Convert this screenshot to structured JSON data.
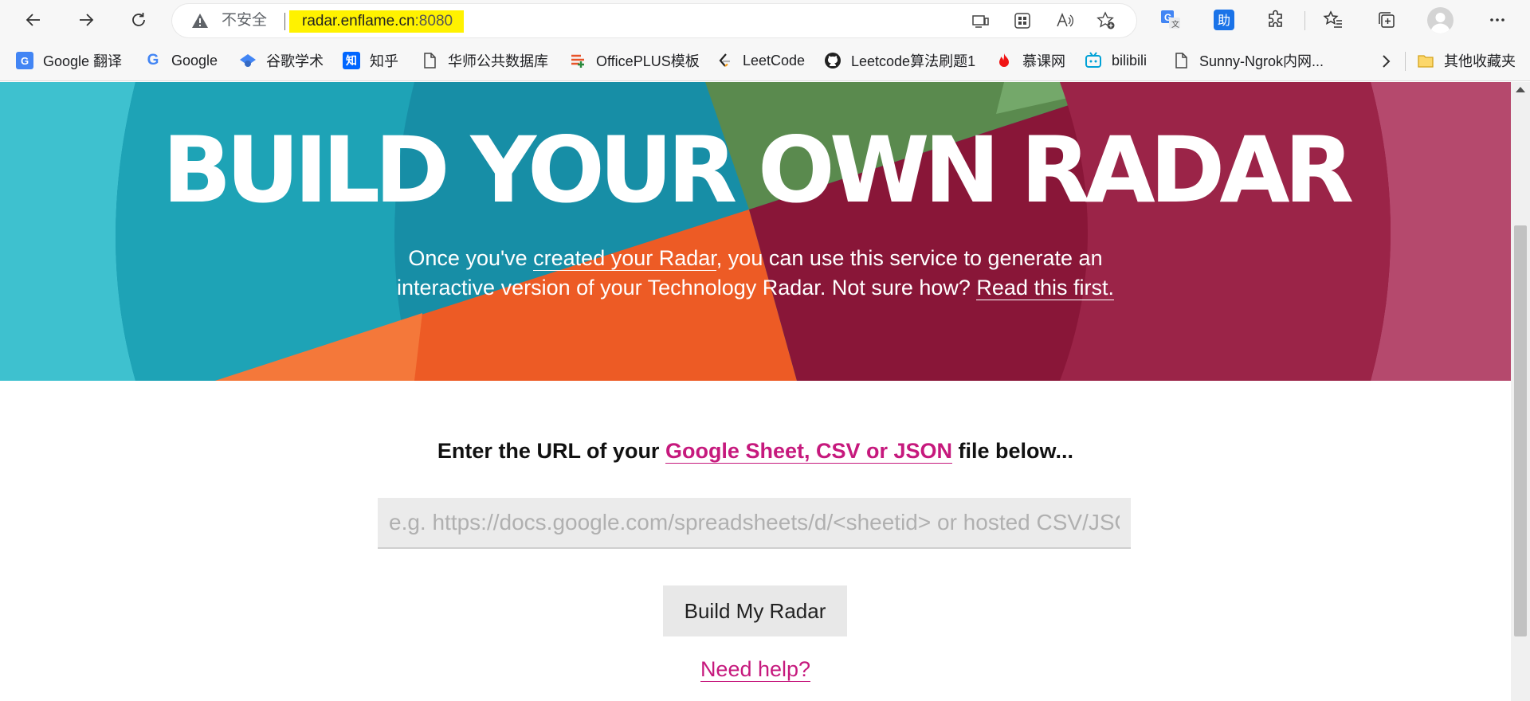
{
  "browser": {
    "security_label": "不安全",
    "url_host": "radar.enflame.cn",
    "url_port": ":8080",
    "help_extension_label": "助"
  },
  "bookmarks": [
    {
      "label": "Google 翻译",
      "icon": "google-translate-icon",
      "color": "#4285f4"
    },
    {
      "label": "Google",
      "icon": "google-icon",
      "color": "#4285f4"
    },
    {
      "label": "谷歌学术",
      "icon": "scholar-icon",
      "color": "#4285f4"
    },
    {
      "label": "知乎",
      "icon": "zhihu-icon",
      "color": "#0066ff"
    },
    {
      "label": "华师公共数据库",
      "icon": "page-icon",
      "color": "#5f6368"
    },
    {
      "label": "OfficePLUS模板",
      "icon": "officeplus-icon",
      "color": "#e8542a"
    },
    {
      "label": "LeetCode",
      "icon": "leetcode-icon",
      "color": "#222222"
    },
    {
      "label": "Leetcode算法刷题1",
      "icon": "github-icon",
      "color": "#222222"
    },
    {
      "label": "慕课网",
      "icon": "flame-icon",
      "color": "#f01414"
    },
    {
      "label": "bilibili",
      "icon": "bilibili-icon",
      "color": "#00a1d6"
    },
    {
      "label": "Sunny-Ngrok内网...",
      "icon": "page-icon",
      "color": "#5f6368"
    },
    {
      "label": "其他收藏夹",
      "icon": "folder-icon",
      "color": "#e8b422"
    }
  ],
  "hero": {
    "title": "BUILD YOUR OWN RADAR",
    "line1_before": "Once you've ",
    "line1_link": "created your Radar",
    "line1_after": ", you can use this service to generate an",
    "line2_before": "interactive version of your Technology Radar. Not sure how? ",
    "line2_link": "Read this first."
  },
  "form": {
    "prompt_before": "Enter the URL of your ",
    "prompt_link": "Google Sheet, CSV or JSON",
    "prompt_after": " file below...",
    "input_placeholder": "e.g. https://docs.google.com/spreadsheets/d/<sheetid> or hosted CSV/JSON file",
    "input_value": "",
    "build_button": "Build My Radar",
    "help_link": "Need help?"
  },
  "colors": {
    "accent_pink": "#c6197d",
    "teal": "#178ea6",
    "orange": "#f0622a",
    "maroon": "#8a1a3c",
    "green": "#5a8a4e",
    "pink": "#b6506f",
    "url_highlight": "#fff200"
  }
}
